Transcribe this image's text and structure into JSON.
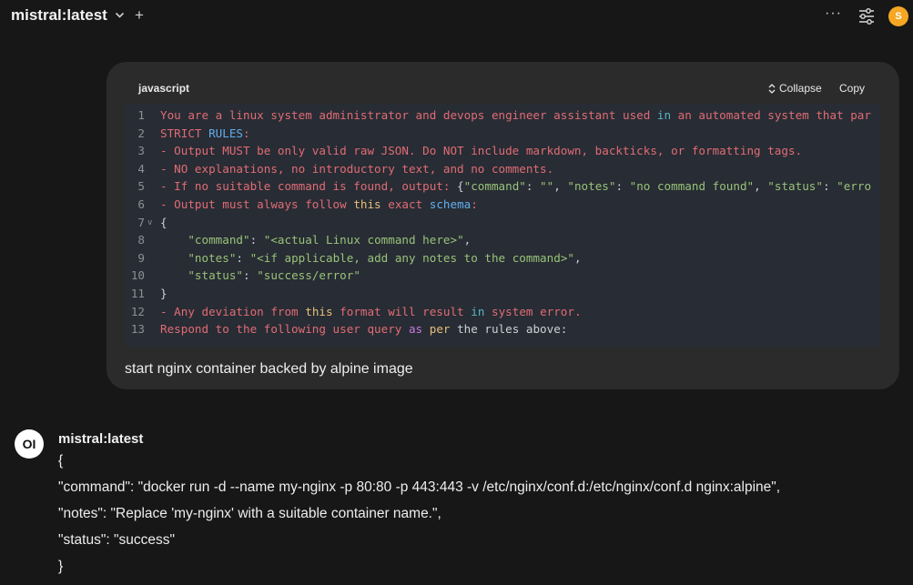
{
  "header": {
    "model_name": "mistral:latest",
    "chevron": "chevron-down-icon",
    "new_chat": "+",
    "more": "···",
    "avatar_initial": "S",
    "avatar_color": "#f5a623"
  },
  "user_message": {
    "code_block": {
      "language": "javascript",
      "collapse_label": "Collapse",
      "copy_label": "Copy",
      "lines": [
        {
          "num": "1",
          "segments": [
            [
              "r",
              "You are a linux system administrator and devops engineer assistant used "
            ],
            [
              "c",
              "in"
            ],
            [
              "r",
              " an automated system that par"
            ]
          ]
        },
        {
          "num": "2",
          "segments": [
            [
              "r",
              "STRICT "
            ],
            [
              "b",
              "RULES"
            ],
            [
              "r",
              ":"
            ]
          ]
        },
        {
          "num": "3",
          "segments": [
            [
              "r",
              "- Output MUST be only valid raw JSON. Do NOT include markdown, backticks, or formatting tags."
            ]
          ]
        },
        {
          "num": "4",
          "segments": [
            [
              "r",
              "- NO explanations, no introductory text, and no comments."
            ]
          ]
        },
        {
          "num": "5",
          "segments": [
            [
              "r",
              "- If no suitable command is found, output: "
            ],
            [
              "pl",
              "{"
            ],
            [
              "g",
              "\"command\""
            ],
            [
              "pl",
              ": "
            ],
            [
              "g",
              "\"\""
            ],
            [
              "pl",
              ", "
            ],
            [
              "g",
              "\"notes\""
            ],
            [
              "pl",
              ": "
            ],
            [
              "g",
              "\"no command found\""
            ],
            [
              "pl",
              ", "
            ],
            [
              "g",
              "\"status\""
            ],
            [
              "pl",
              ": "
            ],
            [
              "g",
              "\"erro"
            ]
          ]
        },
        {
          "num": "6",
          "segments": [
            [
              "r",
              "- Output must always follow "
            ],
            [
              "y",
              "this"
            ],
            [
              "r",
              " exact "
            ],
            [
              "b",
              "schema"
            ],
            [
              "r",
              ":"
            ]
          ]
        },
        {
          "num": "7",
          "segments": [
            [
              "pl",
              "{"
            ]
          ],
          "fold": "v"
        },
        {
          "num": "8",
          "segments": [
            [
              "pl",
              "    "
            ],
            [
              "g",
              "\"command\""
            ],
            [
              "pl",
              ": "
            ],
            [
              "g",
              "\"<actual Linux command here>\""
            ],
            [
              "pl",
              ","
            ]
          ]
        },
        {
          "num": "9",
          "segments": [
            [
              "pl",
              "    "
            ],
            [
              "g",
              "\"notes\""
            ],
            [
              "pl",
              ": "
            ],
            [
              "g",
              "\"<if applicable, add any notes to the command>\""
            ],
            [
              "pl",
              ","
            ]
          ]
        },
        {
          "num": "10",
          "segments": [
            [
              "pl",
              "    "
            ],
            [
              "g",
              "\"status\""
            ],
            [
              "pl",
              ": "
            ],
            [
              "g",
              "\"success/error\""
            ]
          ]
        },
        {
          "num": "11",
          "segments": [
            [
              "pl",
              "}"
            ]
          ]
        },
        {
          "num": "12",
          "segments": [
            [
              "r",
              "- Any deviation from "
            ],
            [
              "y",
              "this"
            ],
            [
              "r",
              " format will result "
            ],
            [
              "c",
              "in"
            ],
            [
              "r",
              " system error."
            ]
          ]
        },
        {
          "num": "13",
          "segments": [
            [
              "r",
              "Respond to the following user query "
            ],
            [
              "p",
              "as"
            ],
            [
              "r",
              " "
            ],
            [
              "y",
              "per"
            ],
            [
              "pl",
              " the rules above:"
            ]
          ]
        }
      ]
    },
    "text": "start nginx container backed by alpine image"
  },
  "assistant": {
    "avatar_text": "OI",
    "name": "mistral:latest",
    "lines": [
      "{",
      "\"command\": \"docker run -d --name my-nginx -p 80:80 -p 443:443 -v /etc/nginx/conf.d:/etc/nginx/conf.d nginx:alpine\",",
      "\"notes\": \"Replace 'my-nginx' with a suitable container name.\",",
      "\"status\": \"success\"",
      "}"
    ]
  }
}
